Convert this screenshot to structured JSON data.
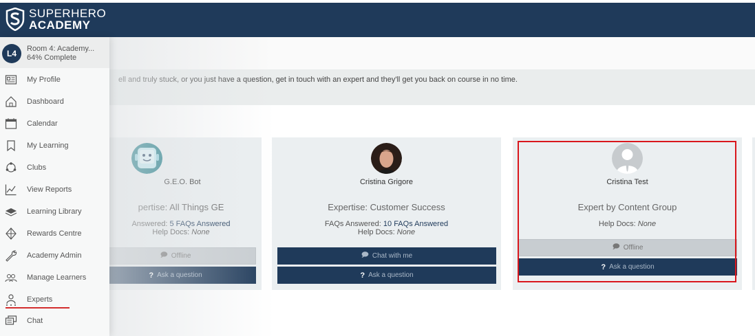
{
  "brand": {
    "line1": "SUPERHERO",
    "line2": "ACADEMY"
  },
  "colors": {
    "navy": "#1f3a5a",
    "highlight": "#d9161c",
    "underline": "#d32d2d"
  },
  "room": {
    "badge": "L4",
    "title": "Room 4: Academy...",
    "progress": "64% Complete"
  },
  "nav": [
    {
      "label": "My Profile",
      "icon": "profile-card-icon"
    },
    {
      "label": "Dashboard",
      "icon": "home-icon"
    },
    {
      "label": "Calendar",
      "icon": "calendar-icon"
    },
    {
      "label": "My Learning",
      "icon": "bookmark-icon"
    },
    {
      "label": "Clubs",
      "icon": "clubs-icon"
    },
    {
      "label": "View Reports",
      "icon": "line-chart-icon"
    },
    {
      "label": "Learning Library",
      "icon": "stack-icon"
    },
    {
      "label": "Rewards Centre",
      "icon": "diamond-icon"
    },
    {
      "label": "Academy Admin",
      "icon": "wrench-icon"
    },
    {
      "label": "Manage Learners",
      "icon": "users-icon"
    },
    {
      "label": "Experts",
      "icon": "expert-icon"
    },
    {
      "label": "Chat",
      "icon": "chat-icon"
    }
  ],
  "intro": "ell and truly stuck, or you just have a question, get in touch with an expert and they'll get you back on course in no time.",
  "experts": [
    {
      "name": "G.E.O. Bot",
      "expertise": "pertise: All Things GE",
      "faq_label": "Answered: ",
      "faq_value": "5 FAQs Answered",
      "help_label": "Help Docs: ",
      "help_value": "None",
      "status_label": "Offline",
      "ask_label": "Ask a question"
    },
    {
      "name": "Cristina Grigore",
      "expertise": "Expertise: Customer Success",
      "faq_label": "FAQs Answered: ",
      "faq_value": "10 FAQs Answered",
      "help_label": "Help Docs: ",
      "help_value": "None",
      "status_label": "Chat with me",
      "ask_label": "Ask a question"
    },
    {
      "name": "Cristina Test",
      "expertise": "Expert by Content Group",
      "help_label": "Help Docs: ",
      "help_value": "None",
      "status_label": "Offline",
      "ask_label": "Ask a question"
    }
  ]
}
